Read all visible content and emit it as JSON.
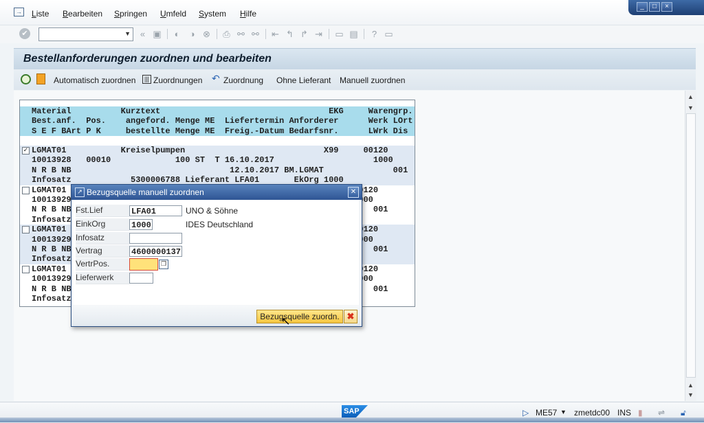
{
  "menubar": {
    "items": [
      "Liste",
      "Bearbeiten",
      "Springen",
      "Umfeld",
      "System",
      "Hilfe"
    ]
  },
  "window_buttons": {
    "minimize": "_",
    "maximize": "□",
    "close": "×"
  },
  "toolbar": {
    "command_field_value": ""
  },
  "title": "Bestellanforderungen zuordnen und bearbeiten",
  "app_toolbar": {
    "auto_assign": "Automatisch zuordnen",
    "assignments": "Zuordnungen",
    "assignment": "Zuordnung",
    "without_vendor": "Ohne Lieferant",
    "manual_assign": "Manuell zuordnen"
  },
  "list": {
    "header_lines": [
      "Material          Kurztext                                  EKG     Warengrp.",
      "Best.anf.  Pos.    angeford. Menge ME  Liefertermin Anforderer      Werk LOrt",
      "S E F BArt P K     bestellte Menge ME  Freig.-Datum Bedarfsnr.      LWrk Dis"
    ],
    "rows": [
      {
        "bg": "bl",
        "checkbox": true,
        "checked": true,
        "text": "LGMAT01           Kreiselpumpen                            X99     00120"
      },
      {
        "bg": "bl",
        "checkbox": false,
        "text": "10013928   00010             100 ST  T 16.10.2017                    1000"
      },
      {
        "bg": "bl",
        "checkbox": false,
        "text": "N R B NB                                12.10.2017 BM.LGMAT              001"
      },
      {
        "bg": "bl",
        "checkbox": false,
        "text": "Infosatz            5300006788 Lieferant LFA01       EkOrg 1000"
      },
      {
        "bg": "wh",
        "checkbox": true,
        "checked": false,
        "text": "LGMAT01                                                          00120"
      },
      {
        "bg": "wh",
        "checkbox": false,
        "text": "10013929                                                         1000"
      },
      {
        "bg": "wh",
        "checkbox": false,
        "text": "N R B NB                                                             001"
      },
      {
        "bg": "wh",
        "checkbox": false,
        "text": "Infosatz"
      },
      {
        "bg": "bl",
        "checkbox": true,
        "checked": false,
        "text": "LGMAT01                                                          00120"
      },
      {
        "bg": "bl",
        "checkbox": false,
        "text": "10013929                                                         1000"
      },
      {
        "bg": "bl",
        "checkbox": false,
        "text": "N R B NB                                                             001"
      },
      {
        "bg": "bl",
        "checkbox": false,
        "text": "Infosatz"
      },
      {
        "bg": "wh",
        "checkbox": true,
        "checked": false,
        "text": "LGMAT01                                                          00120"
      },
      {
        "bg": "wh",
        "checkbox": false,
        "text": "10013929                                                         1000"
      },
      {
        "bg": "wh",
        "checkbox": false,
        "text": "N R B NB                                                             001"
      },
      {
        "bg": "wh",
        "checkbox": false,
        "text": "Infosatz"
      }
    ]
  },
  "dialog": {
    "title": "Bezugsquelle manuell zuordnen",
    "fields": [
      {
        "label": "Fst.Lief",
        "value": "LFA01",
        "desc": "UNO & Söhne"
      },
      {
        "label": "EinkOrg",
        "value": "1000",
        "desc": "IDES Deutschland"
      },
      {
        "label": "Infosatz",
        "value": "",
        "desc": ""
      },
      {
        "label": "Vertrag",
        "value": "4600000137",
        "desc": ""
      },
      {
        "label": "VertrPos.",
        "value": "",
        "desc": ""
      },
      {
        "label": "Lieferwerk",
        "value": "",
        "desc": ""
      }
    ],
    "assign_button": "Bezugsquelle zuordn.",
    "cancel_symbol": "✖"
  },
  "statusbar": {
    "transaction": "ME57",
    "server": "zmetdc00",
    "mode": "INS",
    "logo": "SAP"
  },
  "colors": {
    "header_row": "#a8dcec",
    "highlight_row": "#dfe8f3",
    "title_blue": "#2e5594",
    "button_yellow": "#f6c640",
    "required_field": "#ffe27a"
  }
}
